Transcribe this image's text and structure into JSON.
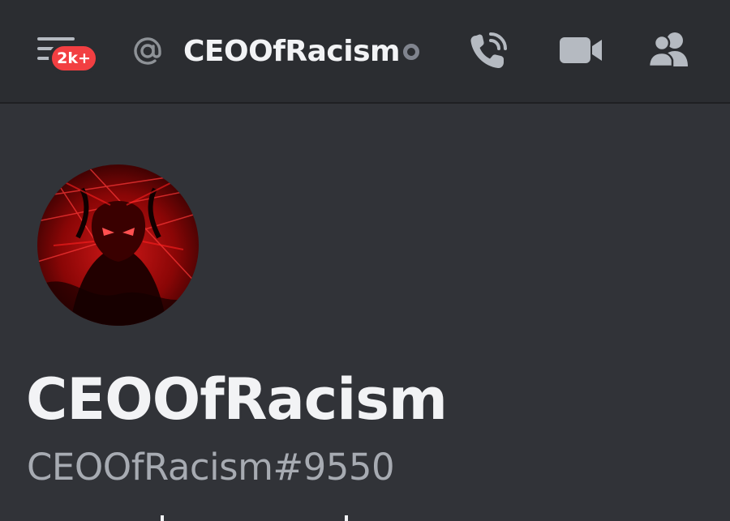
{
  "header": {
    "badge_count": "2k+",
    "channel_title": "CEOOfRacism",
    "icons": {
      "menu": "hamburger-icon",
      "mention": "at-icon",
      "status": "offline-status-icon",
      "call": "phone-call-icon",
      "video": "video-camera-icon",
      "members": "members-icon"
    }
  },
  "profile": {
    "display_name": "CEOOfRacism",
    "user_tag": "CEOOfRacism#9550"
  },
  "colors": {
    "background": "#313338",
    "header_background": "#2b2d31",
    "badge": "#f23f42",
    "text_primary": "#f2f3f5",
    "text_muted": "#a7abb2",
    "icon": "#b5bac1"
  }
}
